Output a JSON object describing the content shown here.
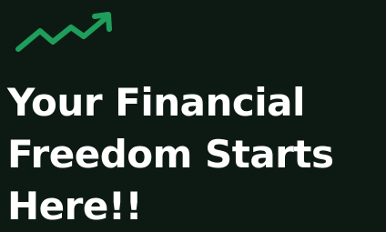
{
  "hero": {
    "icon": "trending-up-icon",
    "accent_color": "#1e9e5a",
    "background_color": "#0d1a14",
    "headline_lines": [
      "Your Financial",
      "Freedom Starts",
      "Here!!"
    ]
  }
}
